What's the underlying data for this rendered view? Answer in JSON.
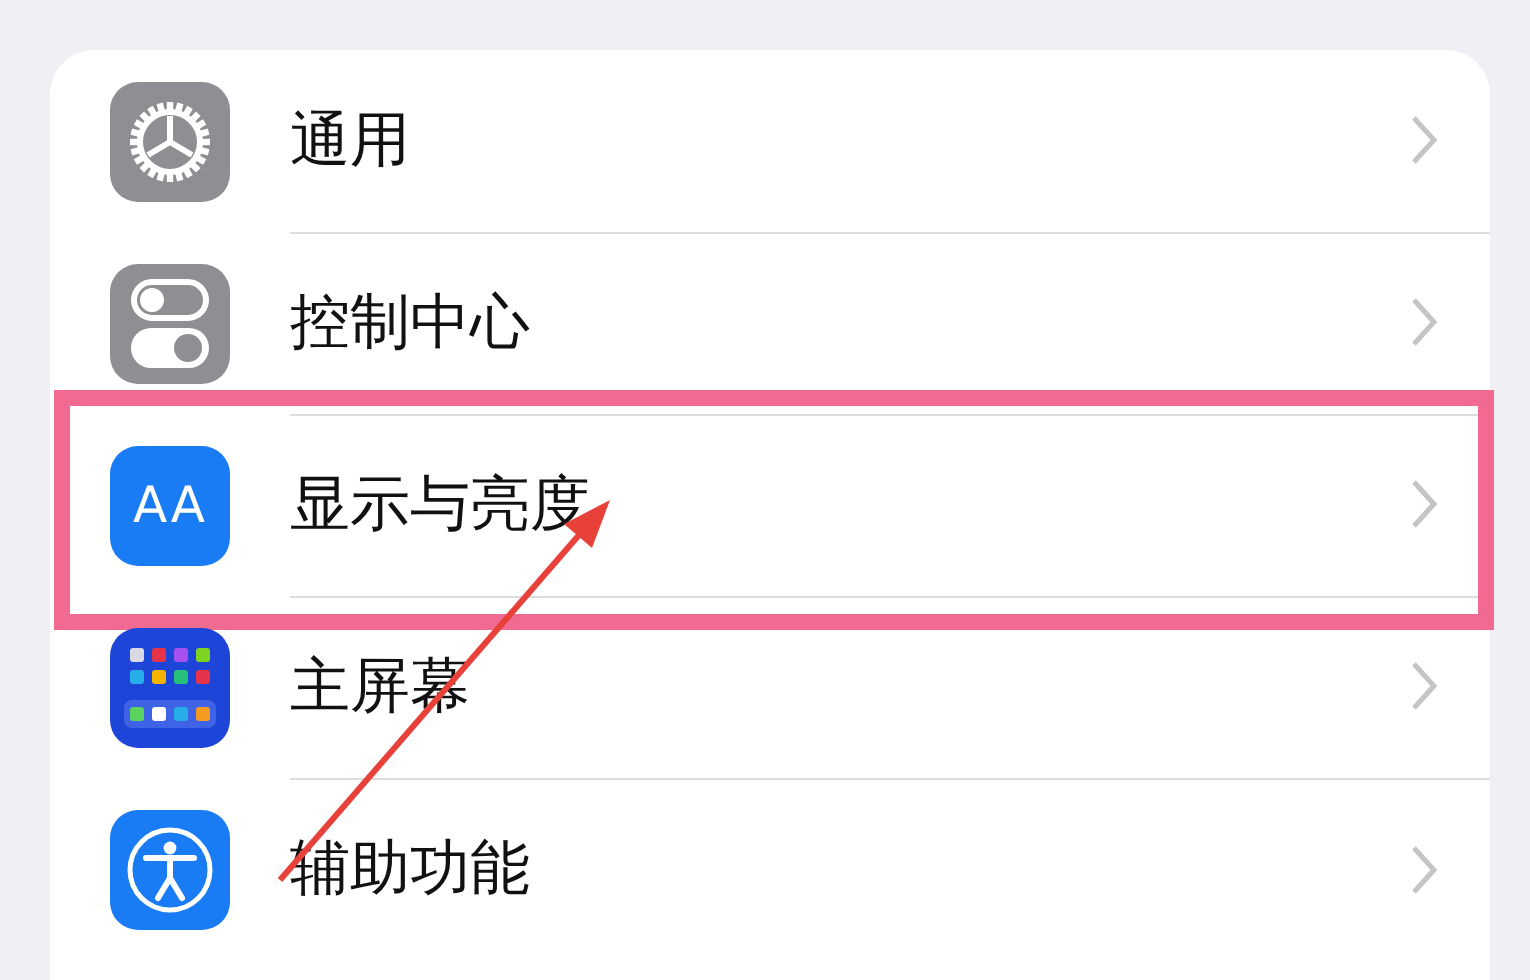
{
  "settings_list": [
    {
      "label": "通用",
      "kind": "gear",
      "highlighted": false
    },
    {
      "label": "控制中心",
      "kind": "toggles",
      "highlighted": false
    },
    {
      "label": "显示与亮度",
      "kind": "text",
      "icon_text": "AA",
      "highlighted": true
    },
    {
      "label": "主屏幕",
      "kind": "grid",
      "highlighted": false
    },
    {
      "label": "辅助功能",
      "kind": "accessibility",
      "highlighted": false
    }
  ]
}
